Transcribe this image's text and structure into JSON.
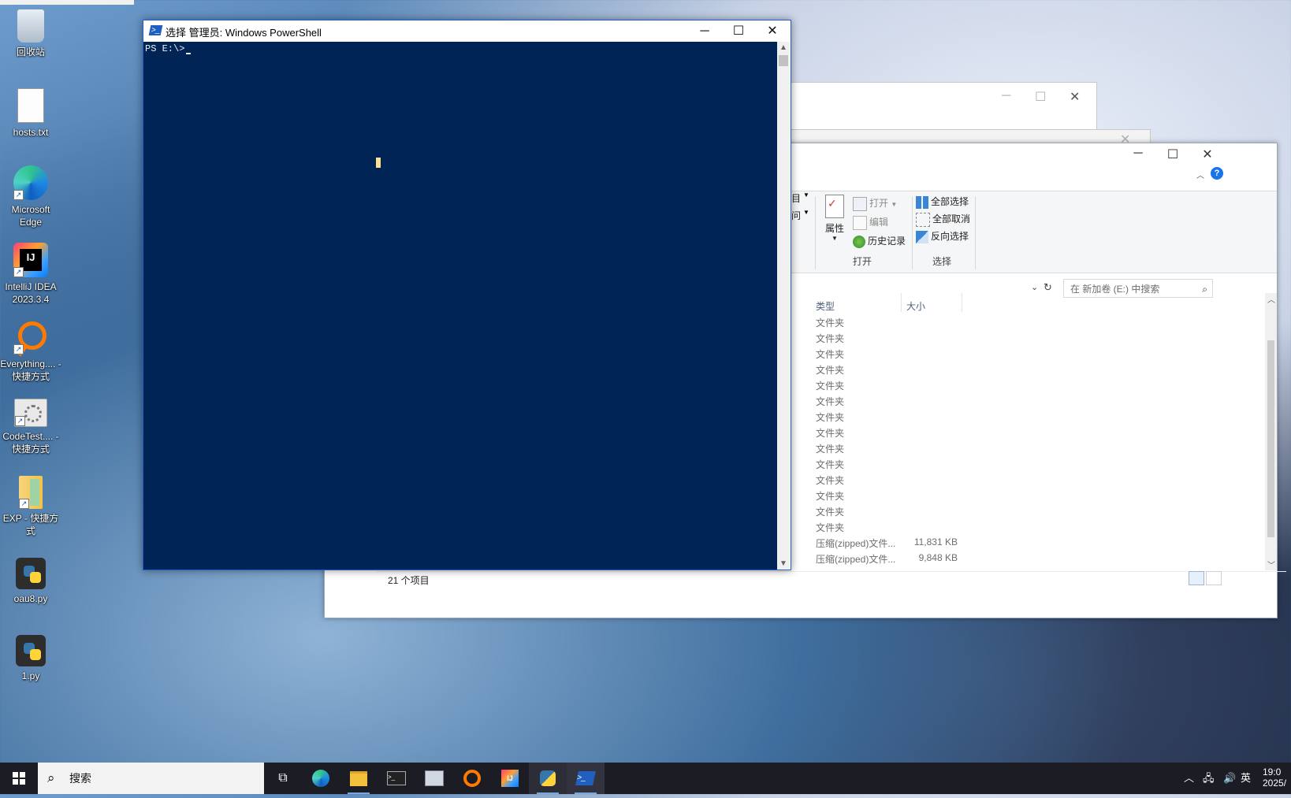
{
  "desktop_icons": [
    {
      "label": "回收站",
      "icon": "recycle-bin-icon"
    },
    {
      "label": "hosts.txt",
      "icon": "text-file-icon"
    },
    {
      "label": "Microsoft Edge",
      "icon": "edge-icon"
    },
    {
      "label": "IntelliJ IDEA 2023.3.4",
      "icon": "intellij-icon"
    },
    {
      "label": "Everything.... - 快捷方式",
      "icon": "everything-icon"
    },
    {
      "label": "CodeTest.... - 快捷方式",
      "icon": "settings-shortcut-icon"
    },
    {
      "label": "EXP - 快捷方式",
      "icon": "folder-shortcut-icon"
    },
    {
      "label": "oau8.py",
      "icon": "python-file-icon"
    },
    {
      "label": "1.py",
      "icon": "python-file-icon"
    }
  ],
  "powershell": {
    "title": "选择 管理员: Windows PowerShell",
    "prompt": "PS E:\\>",
    "background_color": "#012456"
  },
  "explorer": {
    "ribbon": {
      "open_group": {
        "properties": "属性",
        "open": "打开",
        "edit": "编辑",
        "history": "历史记录",
        "label": "打开"
      },
      "select_group": {
        "select_all": "全部选择",
        "select_none": "全部取消",
        "invert": "反向选择",
        "label": "选择"
      },
      "partial_items": [
        "目",
        "问"
      ]
    },
    "search_placeholder": "在 新加卷 (E:) 中搜索",
    "columns": {
      "type": "类型",
      "size": "大小"
    },
    "rows": [
      {
        "type": "文件夹",
        "size": ""
      },
      {
        "type": "文件夹",
        "size": ""
      },
      {
        "type": "文件夹",
        "size": ""
      },
      {
        "type": "文件夹",
        "size": ""
      },
      {
        "type": "文件夹",
        "size": ""
      },
      {
        "type": "文件夹",
        "size": ""
      },
      {
        "type": "文件夹",
        "size": ""
      },
      {
        "type": "文件夹",
        "size": ""
      },
      {
        "type": "文件夹",
        "size": ""
      },
      {
        "type": "文件夹",
        "size": ""
      },
      {
        "type": "文件夹",
        "size": ""
      },
      {
        "type": "文件夹",
        "size": ""
      },
      {
        "type": "文件夹",
        "size": ""
      },
      {
        "type": "文件夹",
        "size": ""
      },
      {
        "type": "压缩(zipped)文件...",
        "size": "11,831 KB"
      },
      {
        "type": "压缩(zipped)文件...",
        "size": "9,848 KB"
      }
    ],
    "status": "21 个项目"
  },
  "taskbar": {
    "search_label": "搜索",
    "apps": [
      "task-view-icon",
      "edge-icon",
      "file-explorer-icon",
      "terminal-icon",
      "remote-desktop-icon",
      "everything-icon",
      "intellij-icon",
      "python-icon",
      "powershell-icon"
    ],
    "ime": "英",
    "time": "19:0",
    "date": "2025/"
  }
}
